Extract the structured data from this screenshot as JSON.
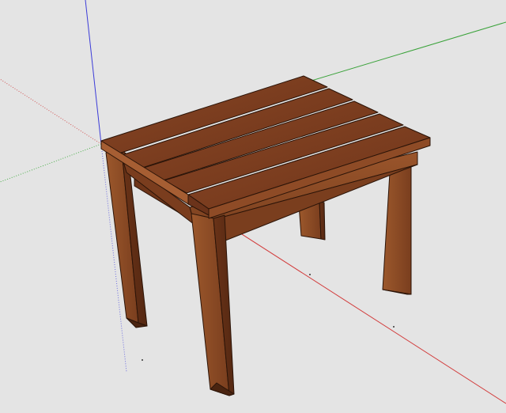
{
  "viewport": {
    "background": "#e4e4e4",
    "axes": {
      "red": "#d23b3b",
      "green": "#3aa23a",
      "blue": "#3b3bd8"
    }
  },
  "model": {
    "wood_top": "#7a3d1e",
    "wood_face": "#8b4a24",
    "wood_dark": "#5a2c14",
    "edge": "#2b1408"
  }
}
